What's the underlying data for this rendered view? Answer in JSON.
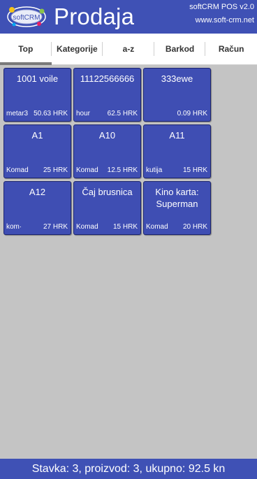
{
  "header": {
    "logo_text": "softCRM",
    "title": "Prodaja",
    "version": "softCRM POS v2.0",
    "website": "www.soft-crm.net"
  },
  "tabs": [
    {
      "label": "Top",
      "active": true
    },
    {
      "label": "Kategorije",
      "active": false
    },
    {
      "label": "a-z",
      "active": false
    },
    {
      "label": "Barkod",
      "active": false
    },
    {
      "label": "Račun",
      "active": false
    }
  ],
  "products": [
    {
      "name": "1001 voile",
      "unit": "metar3",
      "price": "50.63 HRK"
    },
    {
      "name": "11122566666",
      "unit": "hour",
      "price": "62.5 HRK"
    },
    {
      "name": "333ewe",
      "unit": "",
      "price": "0.09 HRK"
    },
    {
      "name": "A1",
      "unit": "Komad",
      "price": "25 HRK"
    },
    {
      "name": "A10",
      "unit": "Komad",
      "price": "12.5 HRK"
    },
    {
      "name": "A11",
      "unit": "kutija",
      "price": "15 HRK"
    },
    {
      "name": "A12",
      "unit": "kom·",
      "price": "27 HRK"
    },
    {
      "name": "Čaj brusnica",
      "unit": "Komad",
      "price": "15 HRK"
    },
    {
      "name": "Kino karta: Superman",
      "unit": "Komad",
      "price": "20 HRK"
    }
  ],
  "footer": {
    "summary": "Stavka: 3, proizvod: 3, ukupno: 92.5 kn"
  },
  "colors": {
    "primary": "#3f51b5",
    "tile": "#3f4eb3",
    "background": "#c4c4c4"
  }
}
